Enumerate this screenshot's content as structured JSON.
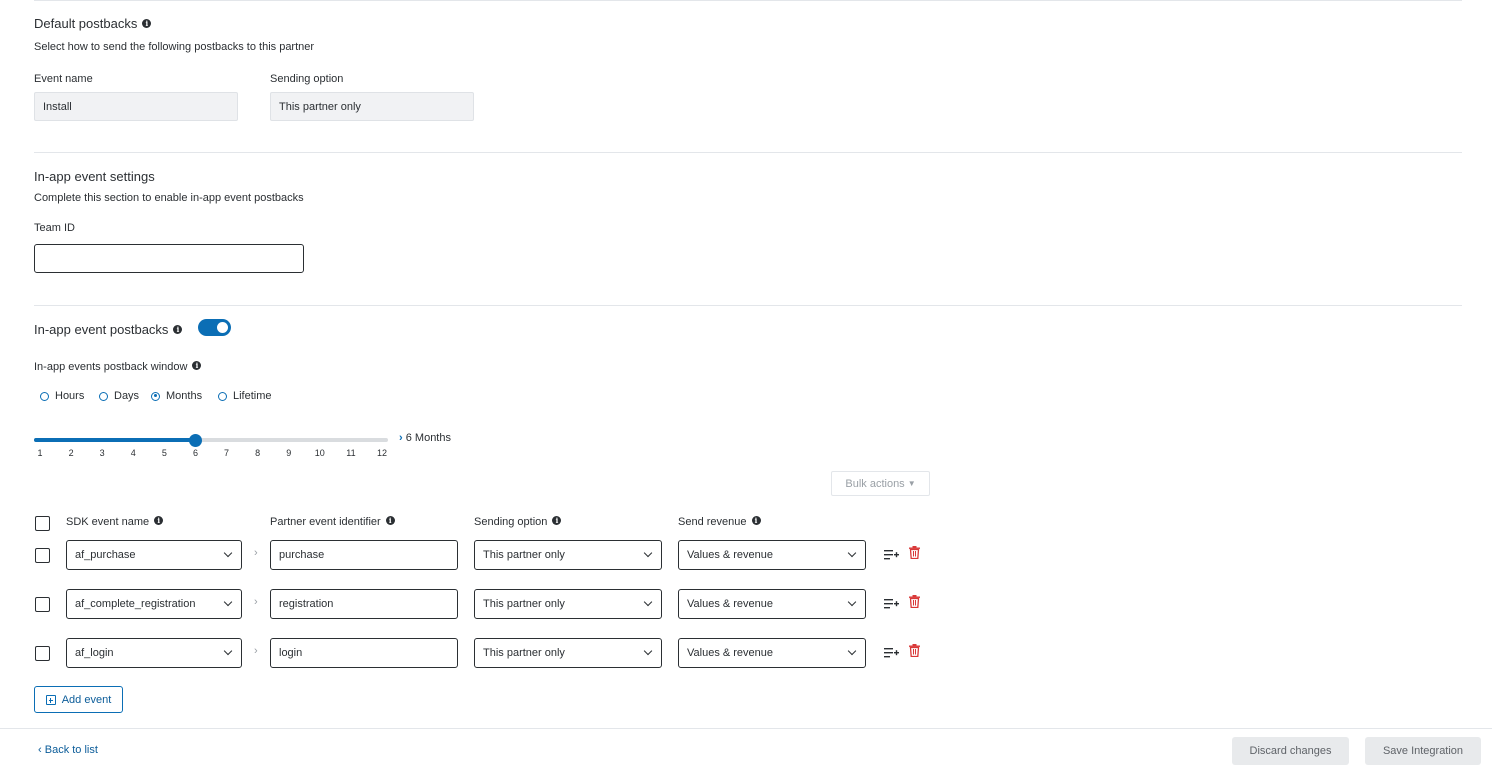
{
  "default_postbacks": {
    "title": "Default postbacks",
    "description": "Select how to send the following postbacks to this partner",
    "event_name_label": "Event name",
    "event_name_value": "Install",
    "sending_option_label": "Sending option",
    "sending_option_value": "This partner only"
  },
  "inapp_settings": {
    "title": "In-app event settings",
    "description": "Complete this section to enable in-app event postbacks",
    "team_id_label": "Team ID",
    "team_id_value": ""
  },
  "inapp_postbacks": {
    "title": "In-app event postbacks",
    "toggle_on": true,
    "window_label": "In-app events postback window",
    "window_options": [
      "Hours",
      "Days",
      "Months",
      "Lifetime"
    ],
    "window_selected": "Months",
    "slider_ticks": [
      "1",
      "2",
      "3",
      "4",
      "5",
      "6",
      "7",
      "8",
      "9",
      "10",
      "11",
      "12"
    ],
    "slider_value": 6,
    "slider_max": 12,
    "slider_readout": "6 Months",
    "bulk_actions_label": "Bulk actions"
  },
  "table": {
    "headers": {
      "sdk_event_name": "SDK event name",
      "partner_event_identifier": "Partner event identifier",
      "sending_option": "Sending option",
      "send_revenue": "Send revenue"
    },
    "rows": [
      {
        "sdk_event": "af_purchase",
        "partner_id": "purchase",
        "sending_option": "This partner only",
        "send_revenue": "Values & revenue"
      },
      {
        "sdk_event": "af_complete_registration",
        "partner_id": "registration",
        "sending_option": "This partner only",
        "send_revenue": "Values & revenue"
      },
      {
        "sdk_event": "af_login",
        "partner_id": "login",
        "sending_option": "This partner only",
        "send_revenue": "Values & revenue"
      }
    ],
    "add_event_label": "Add event"
  },
  "footer": {
    "back_label": "Back to list",
    "discard_label": "Discard changes",
    "save_label": "Save Integration"
  },
  "colors": {
    "accent": "#0b6eb5",
    "delete": "#d93838",
    "divider": "#e3e6ea"
  }
}
